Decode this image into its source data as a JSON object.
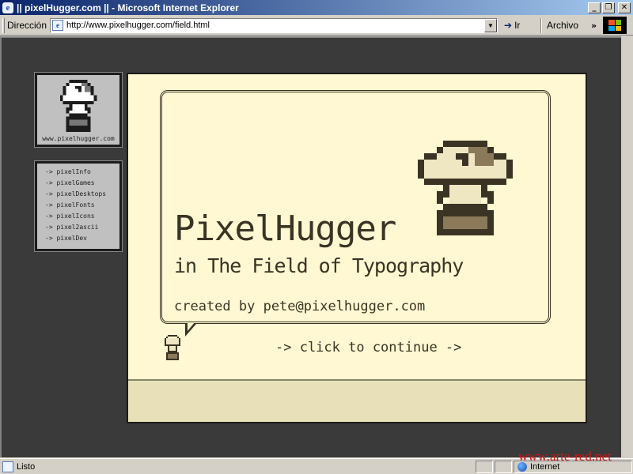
{
  "window": {
    "title": "|| pixelHugger.com || - Microsoft Internet Explorer",
    "minimize": "_",
    "maximize": "❐",
    "close": "✕"
  },
  "addressbar": {
    "label": "Dirección",
    "url": "http://www.pixelhugger.com/field.html",
    "go_label": "Ir",
    "links_label": "Archivo",
    "chevron": "»"
  },
  "sidebar": {
    "logo_text": "www.pixelhugger.com",
    "menu": [
      {
        "label": "-> pixelInfo"
      },
      {
        "label": "-> pixelGames"
      },
      {
        "label": "-> pixelDesktops"
      },
      {
        "label": "-> pixelFonts"
      },
      {
        "label": "-> pixelIcons"
      },
      {
        "label": "-> pixel2ascii"
      },
      {
        "label": "-> pixelDev"
      }
    ]
  },
  "main": {
    "headline": "PixelHugger",
    "subline": "in The Field of Typography",
    "credit": "created by pete@pixelhugger.com",
    "continue_link": "-> click to continue ->"
  },
  "colors": {
    "stage_bg": "#fff8d2",
    "ink": "#3b3424",
    "page_bg": "#3a3a3a"
  },
  "statusbar": {
    "status": "Listo",
    "zone": "Internet"
  },
  "watermark": "www.arte-red.net"
}
